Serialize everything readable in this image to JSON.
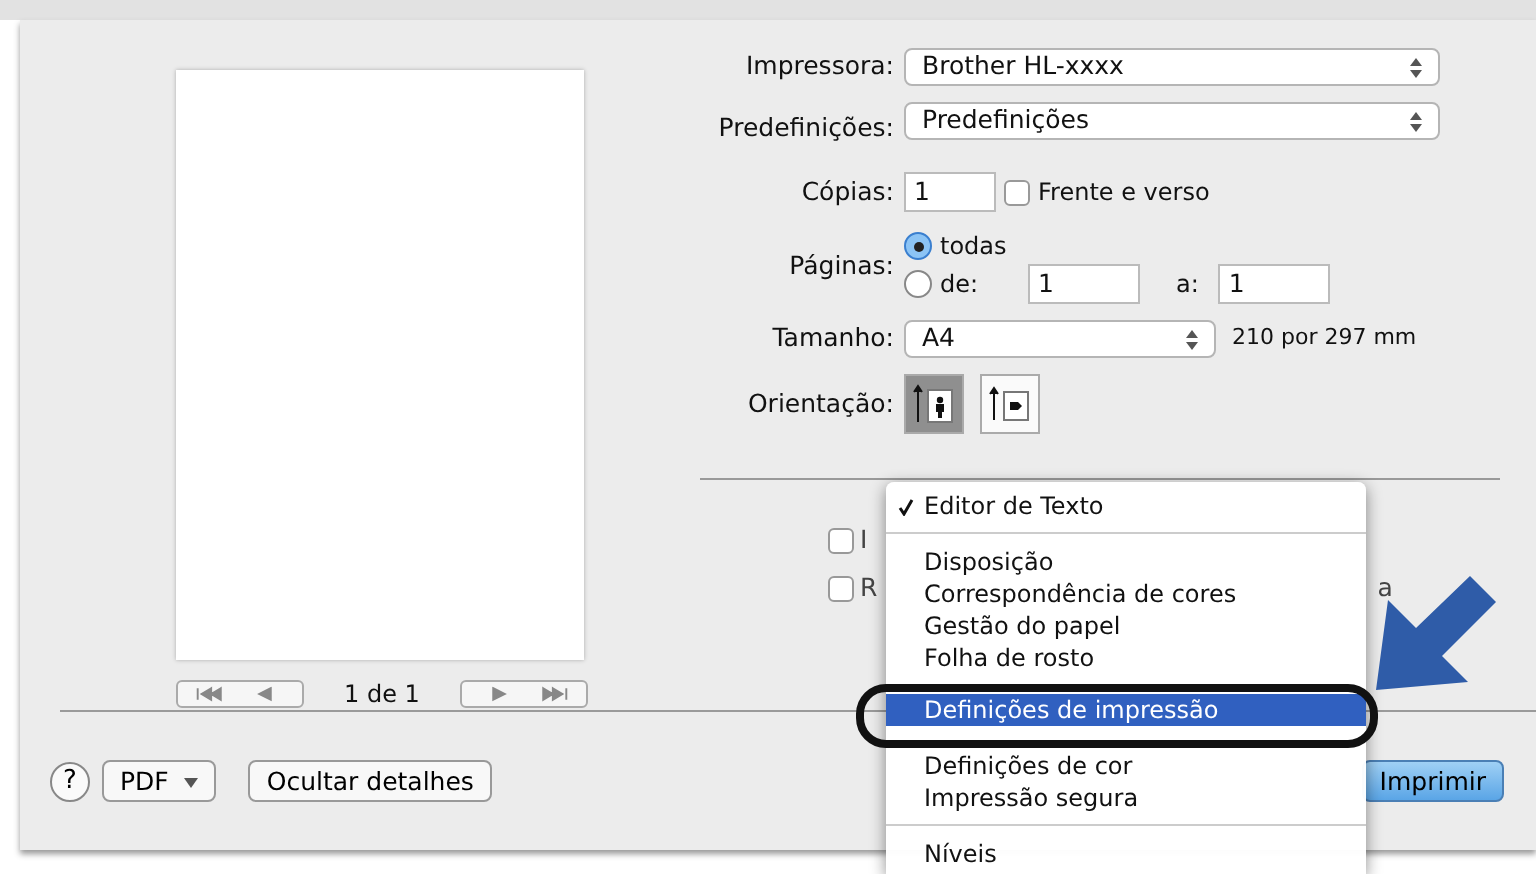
{
  "print_dialog": {
    "preview": {
      "page_indicator": "1 de 1"
    },
    "printer": {
      "label": "Impressora:",
      "value": "Brother HL-xxxx"
    },
    "presets": {
      "label": "Predefinições:",
      "value": "Predefinições"
    },
    "copies": {
      "label": "Cópias:",
      "value": "1"
    },
    "two_sided": {
      "label": "Frente e verso",
      "checked": false
    },
    "pages": {
      "label": "Páginas:",
      "options": [
        {
          "label": "todas",
          "selected": true
        },
        {
          "label": "de:",
          "selected": false
        }
      ],
      "from": "1",
      "to_label": "a:",
      "to": "1"
    },
    "paper_size": {
      "label": "Tamanho:",
      "value": "A4",
      "dimensions": "210 por 297 mm"
    },
    "orientation": {
      "label": "Orientação:",
      "options": [
        {
          "kind": "portrait",
          "selected": true
        },
        {
          "kind": "landscape",
          "selected": false
        }
      ]
    },
    "options": [
      {
        "label_start": "I",
        "checked": false
      },
      {
        "label_start": "R",
        "label_end": "a",
        "checked": false
      }
    ],
    "panel_menu": {
      "items": [
        {
          "kind": "item",
          "label": "Editor de Texto",
          "checked": true,
          "selected": false
        },
        {
          "kind": "separator"
        },
        {
          "kind": "item",
          "label": "Disposição",
          "checked": false,
          "selected": false
        },
        {
          "kind": "item",
          "label": "Correspondência de cores",
          "checked": false,
          "selected": false
        },
        {
          "kind": "item",
          "label": "Gestão do papel",
          "checked": false,
          "selected": false
        },
        {
          "kind": "item",
          "label": "Folha de rosto",
          "checked": false,
          "selected": false
        },
        {
          "kind": "gap"
        },
        {
          "kind": "item",
          "label": "Definições de impressão",
          "checked": false,
          "selected": true
        },
        {
          "kind": "item",
          "label": "Definições de cor",
          "checked": false,
          "selected": false
        },
        {
          "kind": "item",
          "label": "Impressão segura",
          "checked": false,
          "selected": false
        },
        {
          "kind": "separator"
        },
        {
          "kind": "item",
          "label": "Níveis",
          "checked": false,
          "selected": false
        }
      ]
    },
    "help_button": "?",
    "pdf_button": "PDF",
    "details_button": "Ocultar detalhes",
    "print_button": "Imprimir"
  }
}
